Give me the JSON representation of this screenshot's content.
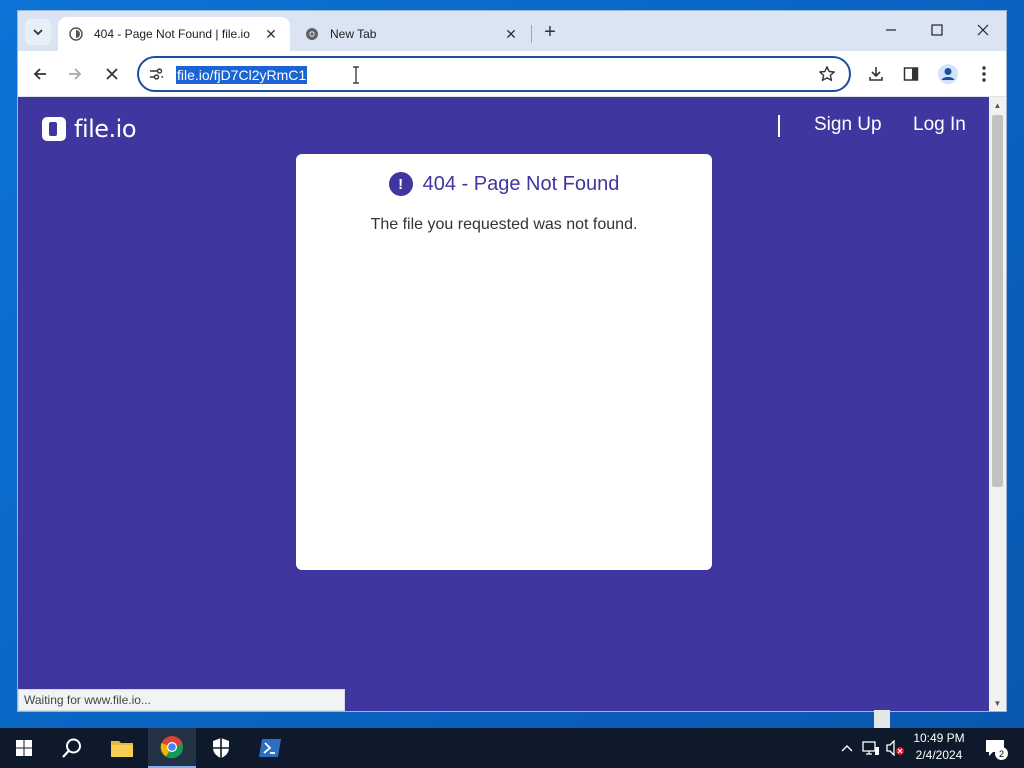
{
  "browser": {
    "tabs": [
      {
        "title": "404 - Page Not Found | file.io",
        "active": true
      },
      {
        "title": "New Tab",
        "active": false
      }
    ],
    "address": "file.io/fjD7Cl2yRmC1",
    "status_text": "Waiting for www.file.io..."
  },
  "page": {
    "logo_text": "file.io",
    "nav": {
      "signup": "Sign Up",
      "login": "Log In"
    },
    "card": {
      "alert_symbol": "!",
      "title": "404 - Page Not Found",
      "message": "The file you requested was not found."
    }
  },
  "taskbar": {
    "time": "10:49 PM",
    "date": "2/4/2024",
    "notification_count": "2"
  },
  "colors": {
    "page_bg": "#3f36a0",
    "accent": "#1a64d4"
  }
}
